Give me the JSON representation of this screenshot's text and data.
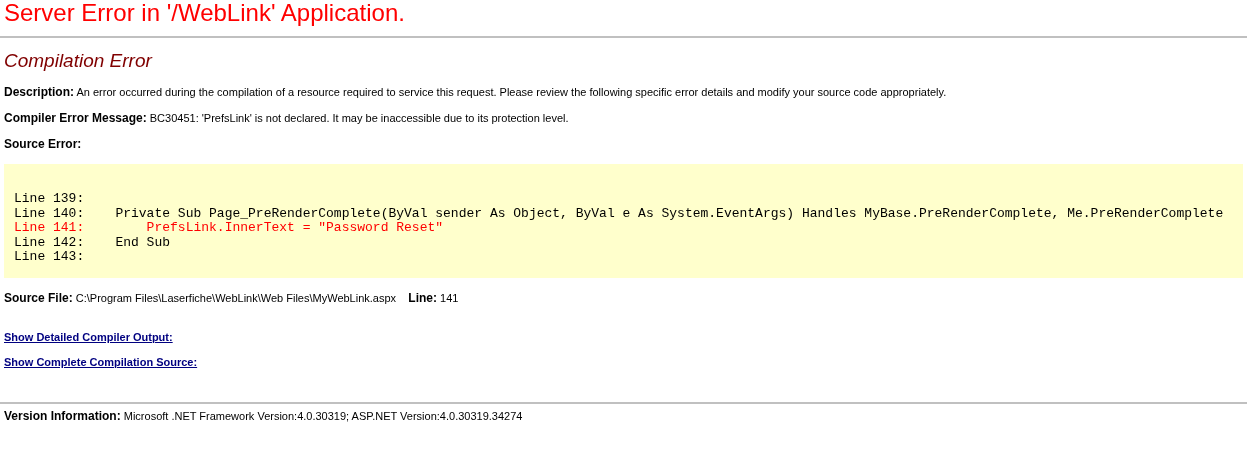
{
  "title": "Server Error in '/WebLink' Application.",
  "heading": "Compilation Error",
  "details": [
    {
      "label": "Description:",
      "text": "An error occurred during the compilation of a resource required to service this request. Please review the following specific error details and modify your source code appropriately."
    },
    {
      "label": "Compiler Error Message:",
      "text": "BC30451: 'PrefsLink' is not declared. It may be inaccessible due to its protection level."
    }
  ],
  "source_error": {
    "label": "Source Error:",
    "lines": [
      {
        "text": "Line 139:",
        "highlighted": false
      },
      {
        "text": "Line 140:    Private Sub Page_PreRenderComplete(ByVal sender As Object, ByVal e As System.EventArgs) Handles MyBase.PreRenderComplete, Me.PreRenderComplete",
        "highlighted": false
      },
      {
        "text": "Line 141:        PrefsLink.InnerText = \"Password Reset\"",
        "highlighted": true
      },
      {
        "text": "Line 142:    End Sub",
        "highlighted": false
      },
      {
        "text": "Line 143:",
        "highlighted": false
      }
    ]
  },
  "source_file": {
    "label": "Source File:",
    "path": "C:\\Program Files\\Laserfiche\\WebLink\\Web Files\\MyWebLink.aspx",
    "line_label": "Line:",
    "line": "141"
  },
  "links": [
    "Show Detailed Compiler Output:",
    "Show Complete Compilation Source:"
  ],
  "version": {
    "label": "Version Information:",
    "text": "Microsoft .NET Framework Version:4.0.30319; ASP.NET Version:4.0.30319.34274"
  }
}
